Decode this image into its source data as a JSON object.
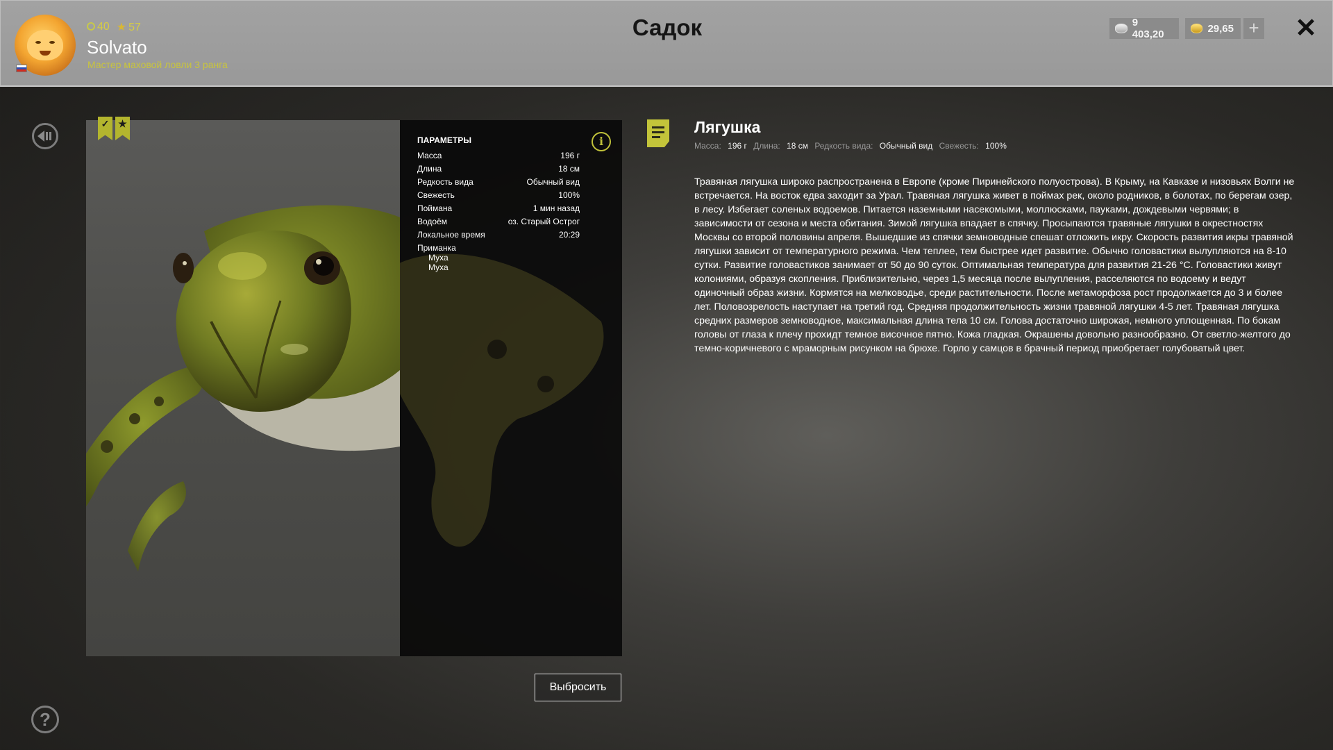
{
  "header": {
    "title": "Садок",
    "player": {
      "level": "40",
      "stars": "57",
      "name": "Solvato",
      "rank": "Мастер маховой ловли 3 ранга"
    },
    "currency": {
      "silver": "9 403,20",
      "gold": "29,65"
    },
    "icons": [
      "avatar",
      "flag-russia",
      "level-icon",
      "star-icon",
      "silver-coin-icon",
      "gold-coin-icon",
      "plus-icon",
      "close-icon"
    ]
  },
  "parameters": {
    "title": "ПАРАМЕТРЫ",
    "rows": [
      {
        "label": "Масса",
        "value": "196 г"
      },
      {
        "label": "Длина",
        "value": "18 см"
      },
      {
        "label": "Редкость вида",
        "value": "Обычный вид"
      },
      {
        "label": "Свежесть",
        "value": "100%"
      },
      {
        "label": "Поймана",
        "value": "1 мин назад"
      },
      {
        "label": "Водоём",
        "value": "оз. Старый Острог"
      },
      {
        "label": "Локальное время",
        "value": "20:29"
      }
    ],
    "bait_label": "Приманка",
    "baits": [
      "Муха",
      "Муха"
    ]
  },
  "actions": {
    "discard": "Выбросить"
  },
  "fish": {
    "name": "Лягушка",
    "summary": [
      {
        "label": "Масса:",
        "value": "196 г"
      },
      {
        "label": "Длина:",
        "value": "18 см"
      },
      {
        "label": "Редкость вида:",
        "value": "Обычный вид"
      },
      {
        "label": "Свежесть:",
        "value": "100%"
      }
    ],
    "description": "Травяная лягушка широко распространена в Европе (кроме Пиринейского полуострова). В Крыму, на Кавказе и низовьях Волги не встречается. На восток едва заходит за Урал. Травяная лягушка живет в поймах рек, около родников, в болотах, по берегам озер, в лесу. Избегает соленых водоемов. Питается наземными насекомыми, моллюсками, пауками, дождевыми червями; в зависимости от сезона и места обитания. Зимой лягушка впадает в спячку. Просыпаются травяные лягушки в окрестностях Москвы со второй половины апреля. Вышедшие из спячки земноводные спешат отложить икру. Скорость развития икры травяной лягушки зависит от температурного режима. Чем теплее, тем быстрее идет развитие. Обычно головастики вылупляются на 8-10 сутки. Развитие головастиков занимает от 50 до 90 суток. Оптимальная температура для развития 21-26 °С. Головастики живут колониями, образуя скопления. Приблизительно, через 1,5 месяца после вылупления, расселяются по водоему и ведут одиночный образ жизни. Кормятся на мелководье, среди растительности. После метаморфоза рост продолжается до 3 и более лет. Половозрелость наступает на третий год. Средняя продолжительность жизни травяной лягушки 4-5 лет. Травяная лягушка средних размеров земноводное, максимальная длина тела 10 см. Голова достаточно широкая, немного уплощенная. По бокам головы от глаза к плечу прохидт темное височное пятно. Кожа гладкая. Окрашены довольно разнообразно. От светло-желтого до темно-коричневого с мраморным рисунком на брюхе. Горло у самцов в брачный период приобретает голубоватый цвет."
  },
  "sidebar": {
    "icons": [
      "back-icon",
      "help-icon",
      "bookmark-check-icon",
      "bookmark-star-icon",
      "info-icon",
      "document-icon"
    ]
  },
  "colors": {
    "accent": "#c3c43a",
    "header_bg": "#9e9e9e",
    "panel_bg": "#0a0a0a"
  }
}
